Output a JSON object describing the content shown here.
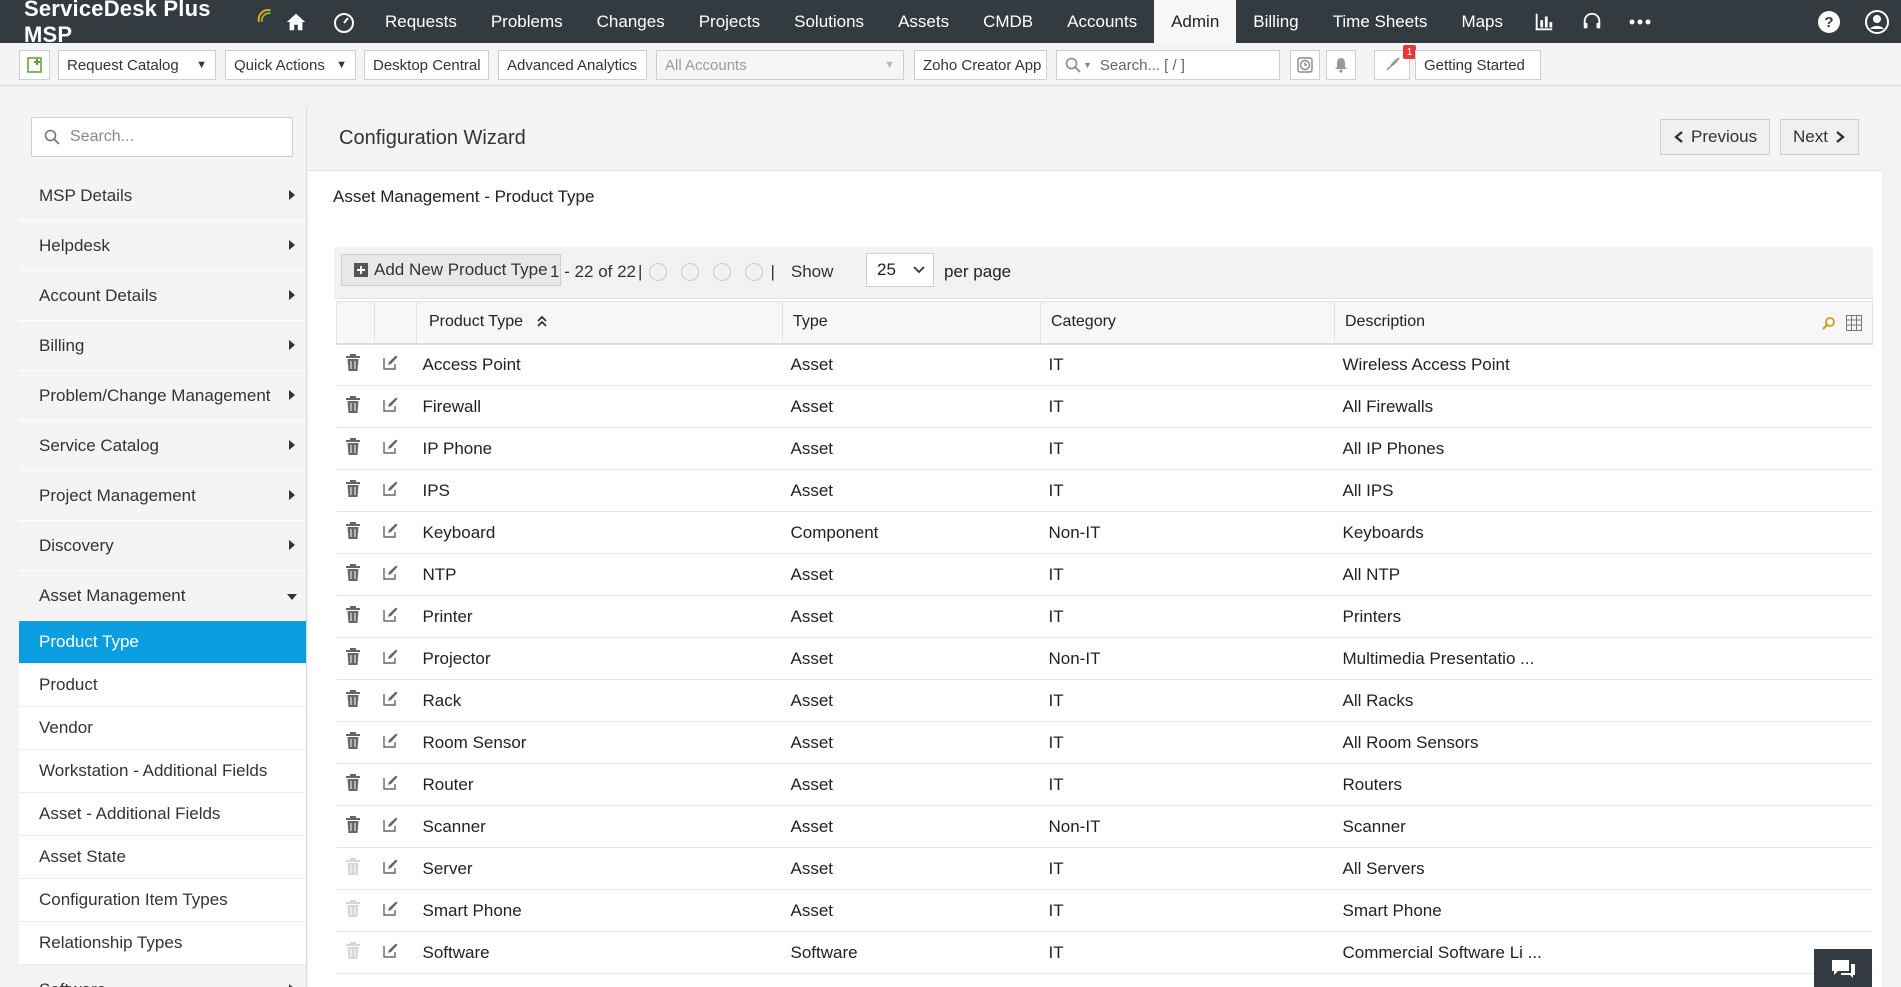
{
  "brand": {
    "name": "ServiceDesk Plus MSP"
  },
  "nav": {
    "items": [
      "Requests",
      "Problems",
      "Changes",
      "Projects",
      "Solutions",
      "Assets",
      "CMDB",
      "Accounts",
      "Admin",
      "Billing",
      "Time Sheets",
      "Maps"
    ],
    "active": "Admin"
  },
  "toolbar": {
    "request_catalog": "Request Catalog",
    "quick_actions": "Quick Actions",
    "desktop_central": "Desktop Central",
    "advanced_analytics": "Advanced Analytics",
    "account_select": "All Accounts",
    "zoho_creator": "Zoho Creator App",
    "search_placeholder": "Search... [ / ]",
    "notification_count": "1",
    "getting_started": "Getting Started"
  },
  "sidebar": {
    "search_placeholder": "Search...",
    "items": [
      "MSP Details",
      "Helpdesk",
      "Account Details",
      "Billing",
      "Problem/Change Management",
      "Service Catalog",
      "Project Management",
      "Discovery",
      "Asset Management"
    ],
    "sub_items": [
      "Product Type",
      "Product",
      "Vendor",
      "Workstation - Additional Fields",
      "Asset - Additional Fields",
      "Asset State",
      "Configuration Item Types",
      "Relationship Types"
    ],
    "active_sub": "Product Type",
    "last_item": "Software"
  },
  "main": {
    "title": "Configuration Wizard",
    "previous": "Previous",
    "next": "Next",
    "section_title": "Asset Management - Product Type",
    "add_button": "Add New Product Type",
    "range": "1 - 22 of 22",
    "show_label": "Show",
    "per_page_value": "25",
    "per_page_label": "per page",
    "columns": [
      "Product Type",
      "Type",
      "Category",
      "Description"
    ],
    "rows": [
      [
        "Access Point",
        "Asset",
        "IT",
        "Wireless Access Point"
      ],
      [
        "Firewall",
        "Asset",
        "IT",
        "All Firewalls"
      ],
      [
        "IP Phone",
        "Asset",
        "IT",
        "All IP Phones"
      ],
      [
        "IPS",
        "Asset",
        "IT",
        "All IPS"
      ],
      [
        "Keyboard",
        "Component",
        "Non-IT",
        "Keyboards"
      ],
      [
        "NTP",
        "Asset",
        "IT",
        "All NTP"
      ],
      [
        "Printer",
        "Asset",
        "IT",
        "Printers"
      ],
      [
        "Projector",
        "Asset",
        "Non-IT",
        "Multimedia Presentatio ..."
      ],
      [
        "Rack",
        "Asset",
        "IT",
        "All Racks"
      ],
      [
        "Room Sensor",
        "Asset",
        "IT",
        "All Room Sensors"
      ],
      [
        "Router",
        "Asset",
        "IT",
        "Routers"
      ],
      [
        "Scanner",
        "Asset",
        "Non-IT",
        "Scanner"
      ],
      [
        "Server",
        "Asset",
        "IT",
        "All Servers"
      ],
      [
        "Smart Phone",
        "Asset",
        "IT",
        "Smart Phone"
      ],
      [
        "Software",
        "Software",
        "IT",
        "Commercial Software Li ..."
      ]
    ],
    "delete_disabled_from_index": 12
  },
  "colors": {
    "topbar": "#333a40",
    "accent": "#0a9de0"
  }
}
